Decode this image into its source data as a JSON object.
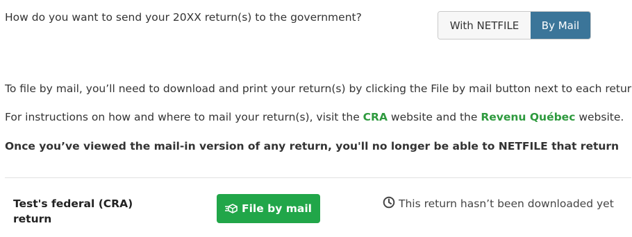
{
  "question": "How do you want to send your 20XX return(s) to the government?",
  "method_toggle": {
    "option_netfile": "With NETFILE",
    "option_mail": "By Mail",
    "selected": "By Mail"
  },
  "instructions": {
    "line1": "To file by mail, you’ll need to download and print your return(s) by clicking the File by mail button next to each return.",
    "line2_prefix": "For instructions on how and where to mail your return(s), visit the ",
    "line2_link_cra": "CRA",
    "line2_middle": " website and the ",
    "line2_link_rq": "Revenu Québec",
    "line2_suffix": " website.",
    "warning": "Once you’ve viewed the mail-in version of any return, you'll no longer be able to NETFILE that return"
  },
  "returns": [
    {
      "title": "Test's federal (CRA) return",
      "button_label": "File by mail",
      "status": "This return hasn’t been downloaded yet"
    }
  ],
  "colors": {
    "primary_blue": "#3b7599",
    "green": "#21a649",
    "link_green": "#2e9a3e"
  },
  "icons": {
    "button_icon": "fast-delivery-box-icon",
    "status_icon": "clock-icon"
  }
}
